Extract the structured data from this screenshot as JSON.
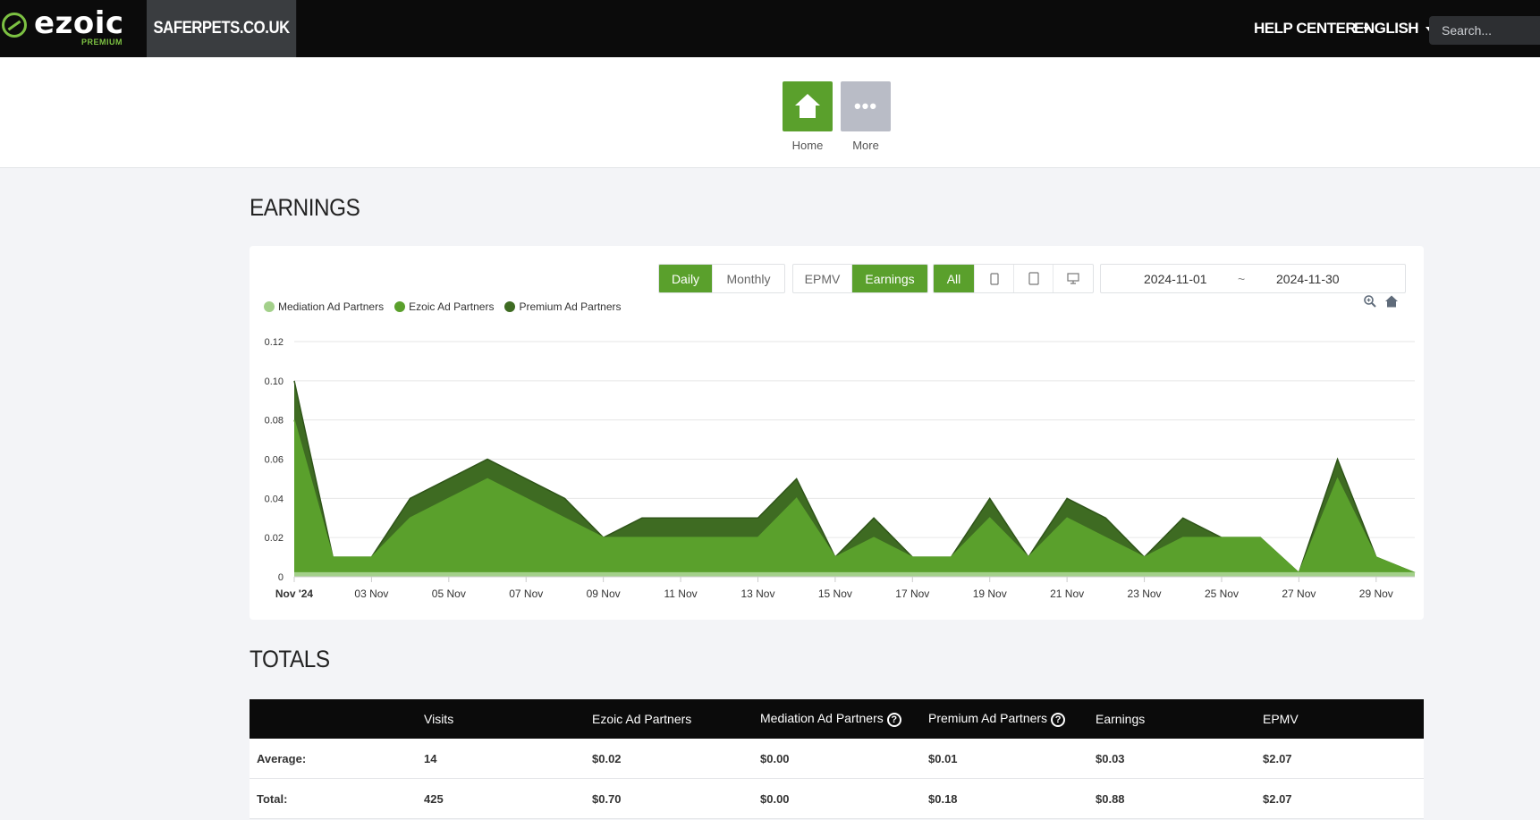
{
  "header": {
    "logo_text": "ezoic",
    "logo_sub": "PREMIUM",
    "site_name": "SAFERPETS.CO.UK",
    "help_center": "HELP CENTER",
    "language": "ENGLISH",
    "search_placeholder": "Search..."
  },
  "quick_nav": {
    "home_label": "Home",
    "more_label": "More"
  },
  "earnings": {
    "title": "EARNINGS",
    "period_buttons": {
      "daily": "Daily",
      "monthly": "Monthly",
      "selected": "Daily"
    },
    "metric_buttons": {
      "epmv": "EPMV",
      "earnings": "Earnings",
      "selected": "Earnings"
    },
    "device_buttons": {
      "all": "All",
      "icons": [
        "mobile-icon",
        "tablet-icon",
        "desktop-icon"
      ],
      "selected": "All"
    },
    "date_start": "2024-11-01",
    "date_sep": "~",
    "date_end": "2024-11-30",
    "tools": [
      "zoom-icon",
      "reset-zoom-home-icon"
    ]
  },
  "chart_data": {
    "type": "area",
    "stacked": true,
    "x": [
      "2024-11-01",
      "2024-11-02",
      "2024-11-03",
      "2024-11-04",
      "2024-11-05",
      "2024-11-06",
      "2024-11-07",
      "2024-11-08",
      "2024-11-09",
      "2024-11-10",
      "2024-11-11",
      "2024-11-12",
      "2024-11-13",
      "2024-11-14",
      "2024-11-15",
      "2024-11-16",
      "2024-11-17",
      "2024-11-18",
      "2024-11-19",
      "2024-11-20",
      "2024-11-21",
      "2024-11-22",
      "2024-11-23",
      "2024-11-24",
      "2024-11-25",
      "2024-11-26",
      "2024-11-27",
      "2024-11-28",
      "2024-11-29",
      "2024-11-30"
    ],
    "x_tick_labels": [
      "Nov '24",
      "03 Nov",
      "05 Nov",
      "07 Nov",
      "09 Nov",
      "11 Nov",
      "13 Nov",
      "15 Nov",
      "17 Nov",
      "19 Nov",
      "21 Nov",
      "23 Nov",
      "25 Nov",
      "27 Nov",
      "29 Nov"
    ],
    "y_tick_labels": [
      "0",
      "0.02",
      "0.04",
      "0.06",
      "0.08",
      "0.10",
      "0.12"
    ],
    "ylim": [
      0,
      0.12
    ],
    "grid": true,
    "legend_position": "top-left",
    "series": [
      {
        "name": "Mediation Ad Partners",
        "color": "#a3d08a",
        "values": [
          0.002,
          0.002,
          0.002,
          0.002,
          0.002,
          0.002,
          0.002,
          0.002,
          0.002,
          0.002,
          0.002,
          0.002,
          0.002,
          0.002,
          0.002,
          0.002,
          0.002,
          0.002,
          0.002,
          0.002,
          0.002,
          0.002,
          0.002,
          0.002,
          0.002,
          0.002,
          0.002,
          0.002,
          0.002,
          0.002
        ]
      },
      {
        "name": "Ezoic Ad Partners",
        "color": "#5aa02c",
        "values": [
          0.078,
          0.008,
          0.008,
          0.028,
          0.038,
          0.048,
          0.038,
          0.028,
          0.018,
          0.018,
          0.018,
          0.018,
          0.018,
          0.038,
          0.008,
          0.018,
          0.008,
          0.008,
          0.028,
          0.008,
          0.028,
          0.018,
          0.008,
          0.018,
          0.018,
          0.018,
          0.0,
          0.048,
          0.008,
          0.0
        ]
      },
      {
        "name": "Premium Ad Partners",
        "color": "#3e6b22",
        "values": [
          0.02,
          0.0,
          0.0,
          0.01,
          0.01,
          0.01,
          0.01,
          0.01,
          0.0,
          0.01,
          0.01,
          0.01,
          0.01,
          0.01,
          0.0,
          0.01,
          0.0,
          0.0,
          0.01,
          0.0,
          0.01,
          0.01,
          0.0,
          0.01,
          0.0,
          0.0,
          0.0,
          0.01,
          0.0,
          0.0
        ]
      }
    ]
  },
  "totals": {
    "title": "TOTALS",
    "columns": [
      "",
      "Visits",
      "Ezoic Ad Partners",
      "Mediation Ad Partners",
      "Premium Ad Partners",
      "Earnings",
      "EPMV"
    ],
    "rows": [
      [
        "Average:",
        "14",
        "$0.02",
        "$0.00",
        "$0.01",
        "$0.03",
        "$2.07"
      ],
      [
        "Total:",
        "425",
        "$0.70",
        "$0.00",
        "$0.18",
        "$0.88",
        "$2.07"
      ]
    ]
  }
}
